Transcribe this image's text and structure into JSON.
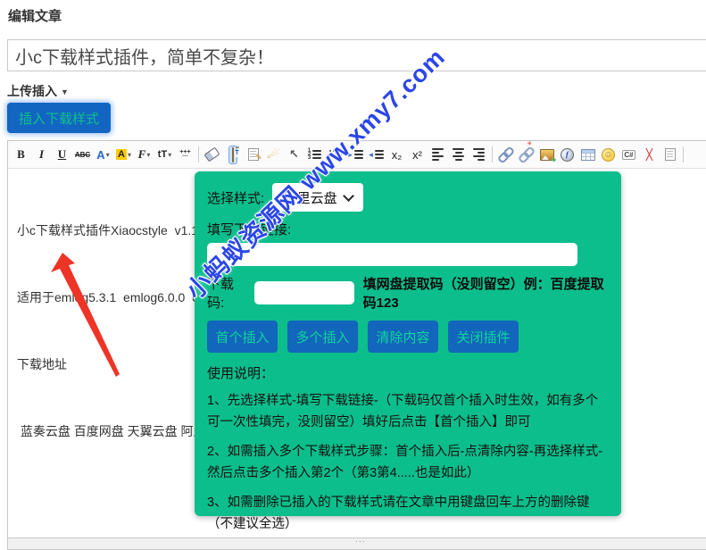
{
  "header": {
    "page_title": "编辑文章"
  },
  "title_field": {
    "value": "小c下载样式插件，简单不复杂！"
  },
  "upload_insert": {
    "label": "上传插入",
    "caret": "▼"
  },
  "insert_button": {
    "label": "插入下载样式"
  },
  "toolbar": {
    "glyphs": {
      "bold": "B",
      "italic": "I",
      "underline": "U",
      "strike": "ABC",
      "forecolor": "A",
      "hilite": "A",
      "fontname": "F",
      "fontsize": "tT",
      "caret": "▾",
      "lineheight_top": "+++",
      "lineheight_bottom": "···",
      "broom": "☄",
      "cursor": "↖",
      "numcol": "1\n2\n3",
      "indent_arrow": "▸",
      "outdent_arrow": "◂",
      "subscript": "x₂",
      "superscript": "x²",
      "unlink_burst": "✳",
      "media_f": "ƒ",
      "smiley": "☺",
      "code": "C#",
      "fullscreen": "╳"
    }
  },
  "editor": {
    "lines": [
      "小c下载样式插件Xiaocstyle  v1.1",
      "适用于emlog5.3.1  emlog6.0.0  emlog",
      "下载地址",
      " 蓝奏云盘 百度网盘 天翼云盘 阿里云盘"
    ]
  },
  "panel": {
    "style_label": "选择样式:",
    "style_value": "阿里云盘",
    "link_label": "填写下载链接:",
    "code_label": "下载码:",
    "code_hint": "填网盘提取码（没则留空）例：百度提取码123",
    "buttons": [
      {
        "label": "首个插入"
      },
      {
        "label": "多个插入"
      },
      {
        "label": "清除内容"
      },
      {
        "label": "关闭插件"
      }
    ],
    "usage_title": "使用说明：",
    "instructions": [
      "1、先选择样式-填写下载链接-（下载码仅首个插入时生效，如有多个可一次性填完，没则留空）填好后点击【首个插入】即可",
      "2、如需插入多个下载样式步骤：首个插入后-点清除内容-再选择样式-然后点击多个插入第2个（第3第4.....也是如此）",
      "3、如需删除已插入的下载样式请在文章中用键盘回车上方的删除键（不建议全选）"
    ]
  },
  "watermark": {
    "text": "小蚂蚁资源网 www.xmy7.com",
    "color": "#2b46e8"
  },
  "statusbar": {
    "grip": "···"
  },
  "colors": {
    "panel_green": "#0cbe8c",
    "button_blue": "#1266c1",
    "button_text_green": "#0fd49c",
    "arrow_red": "#ee3426",
    "watermark_blue": "#2b46e8"
  }
}
